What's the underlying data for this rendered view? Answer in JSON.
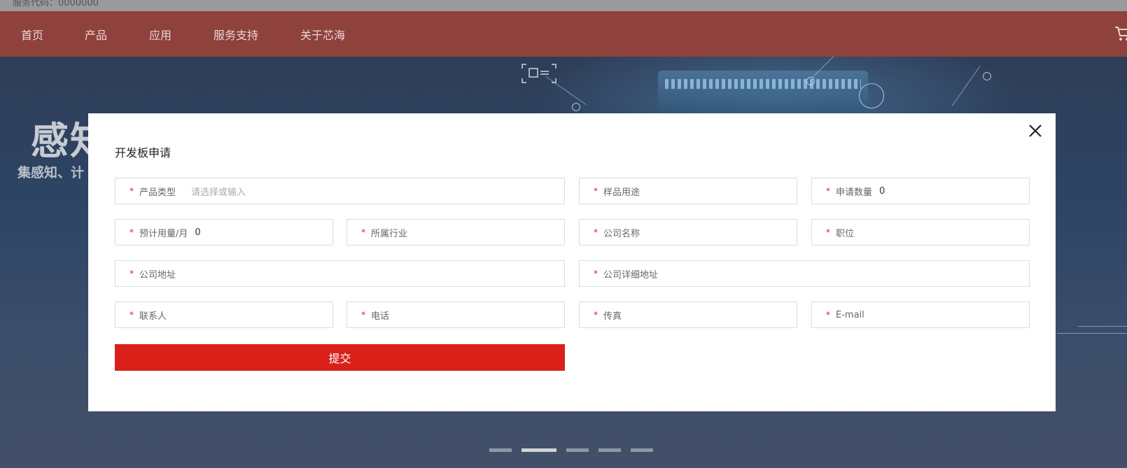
{
  "topbar": {
    "hotline": "服务代码：0000000"
  },
  "nav": {
    "items": [
      {
        "label": "首页"
      },
      {
        "label": "产品"
      },
      {
        "label": "应用"
      },
      {
        "label": "服务支持"
      },
      {
        "label": "关于芯海"
      }
    ]
  },
  "hero": {
    "title": "感知",
    "subtitle": "集感知、计"
  },
  "carousel": {
    "count": 5,
    "active_index": 1
  },
  "modal": {
    "title": "开发板申请",
    "required_mark": "*",
    "fields": {
      "product_type": {
        "label": "产品类型",
        "placeholder": "请选择或输入",
        "value": ""
      },
      "sample_usage": {
        "label": "样品用途",
        "value": ""
      },
      "apply_quantity": {
        "label": "申请数量",
        "value": "0"
      },
      "monthly_usage": {
        "label": "预计用量/月",
        "value": "0"
      },
      "industry": {
        "label": "所属行业",
        "value": ""
      },
      "company_name": {
        "label": "公司名称",
        "value": ""
      },
      "position": {
        "label": "职位",
        "value": ""
      },
      "company_address": {
        "label": "公司地址",
        "value": ""
      },
      "company_detail_address": {
        "label": "公司详细地址",
        "value": ""
      },
      "contact": {
        "label": "联系人",
        "value": ""
      },
      "phone": {
        "label": "电话",
        "value": ""
      },
      "fax": {
        "label": "传真",
        "value": ""
      },
      "email": {
        "label": "E-mail",
        "value": ""
      }
    },
    "submit_label": "提交"
  },
  "colors": {
    "nav_bg": "#8f413c",
    "submit_bg": "#d9211a",
    "required": "#d9241b"
  }
}
